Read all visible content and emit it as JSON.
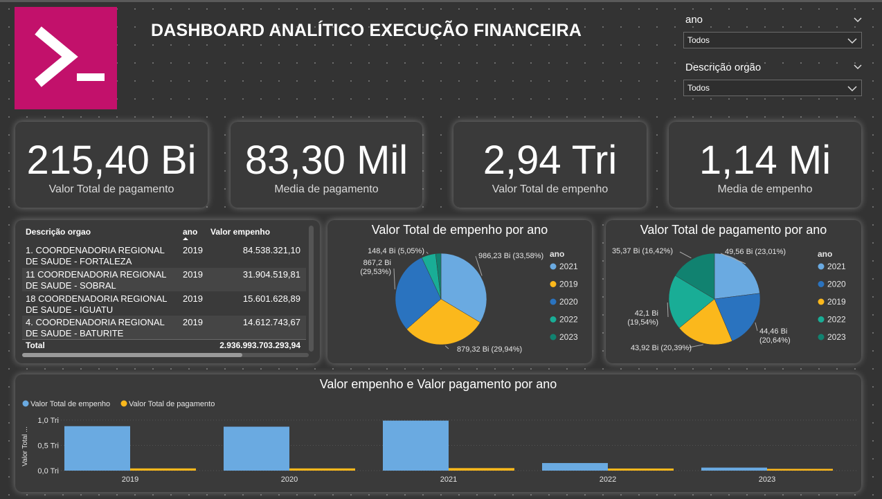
{
  "header": {
    "title": "DASHBOARD ANALÍTICO EXECUÇÃO FINANCEIRA"
  },
  "filters": [
    {
      "label": "ano",
      "value": "Todos"
    },
    {
      "label": "Descrição orgão",
      "value": "Todos"
    }
  ],
  "kpis": [
    {
      "value": "215,40 Bi",
      "label": "Valor Total de pagamento"
    },
    {
      "value": "83,30 Mil",
      "label": "Media de pagamento"
    },
    {
      "value": "2,94 Tri",
      "label": "Valor Total de empenho"
    },
    {
      "value": "1,14 Mi",
      "label": "Media de empenho"
    }
  ],
  "table": {
    "headers": [
      "Descrição orgao",
      "ano",
      "Valor empenho"
    ],
    "rows": [
      {
        "orgao": "1. COORDENADORIA REGIONAL DE SAUDE - FORTALEZA",
        "ano": "2019",
        "valor": "84.538.321,10"
      },
      {
        "orgao": "11 COORDENADORIA REGIONAL DE SAUDE - SOBRAL",
        "ano": "2019",
        "valor": "31.904.519,81"
      },
      {
        "orgao": "18 COORDENADORIA REGIONAL DE SAUDE - IGUATU",
        "ano": "2019",
        "valor": "15.601.628,89"
      },
      {
        "orgao": "4. COORDENADORIA REGIONAL DE SAUDE - BATURITE",
        "ano": "2019",
        "valor": "14.612.743,67"
      }
    ],
    "total_label": "Total",
    "total_value": "2.936.993.703.293,94"
  },
  "colors": {
    "2019": "#fbb81c",
    "2020": "#2a73bf",
    "2021": "#6aaae1",
    "2022": "#19ad96",
    "2023": "#118270"
  },
  "chart_data": [
    {
      "type": "pie",
      "title": "Valor Total de empenho por ano",
      "legend_title": "ano",
      "legend": [
        "2021",
        "2019",
        "2020",
        "2022",
        "2023"
      ],
      "slices": [
        {
          "name": "2021",
          "value": 986.23,
          "label": "986,23 Bi (33,58%)"
        },
        {
          "name": "2019",
          "value": 879.32,
          "label": "879,32 Bi (29,94%)"
        },
        {
          "name": "2020",
          "value": 867.2,
          "label": "867,2 Bi (29,53%)"
        },
        {
          "name": "2022",
          "value": 148.4,
          "label": "148,4 Bi (5,05%)"
        },
        {
          "name": "2023",
          "value": 55.6,
          "label": ""
        }
      ]
    },
    {
      "type": "pie",
      "title": "Valor Total de pagamento por ano",
      "legend_title": "ano",
      "legend": [
        "2021",
        "2020",
        "2019",
        "2022",
        "2023"
      ],
      "slices": [
        {
          "name": "2021",
          "value": 49.56,
          "label": "49,56 Bi (23,01%)"
        },
        {
          "name": "2020",
          "value": 44.46,
          "label": "44,46 Bi (20,64%)"
        },
        {
          "name": "2019",
          "value": 43.92,
          "label": "43,92 Bi (20,39%)"
        },
        {
          "name": "2022",
          "value": 42.1,
          "label": "42,1 Bi (19,54%)"
        },
        {
          "name": "2023",
          "value": 35.37,
          "label": "35,37 Bi (16,42%)"
        }
      ]
    },
    {
      "type": "bar",
      "title": "Valor empenho e Valor pagamento por ano",
      "ylabel": "Valor Total ...",
      "categories": [
        "2019",
        "2020",
        "2021",
        "2022",
        "2023"
      ],
      "yticks": [
        "0,0 Tri",
        "0,5 Tri",
        "1,0 Tri"
      ],
      "ylim": [
        0,
        1.05
      ],
      "series": [
        {
          "name": "Valor Total de empenho",
          "color": "#6aaae1",
          "values": [
            0.88,
            0.87,
            0.99,
            0.15,
            0.06
          ]
        },
        {
          "name": "Valor Total de pagamento",
          "color": "#fbb81c",
          "values": [
            0.044,
            0.044,
            0.05,
            0.042,
            0.035
          ]
        }
      ]
    }
  ]
}
